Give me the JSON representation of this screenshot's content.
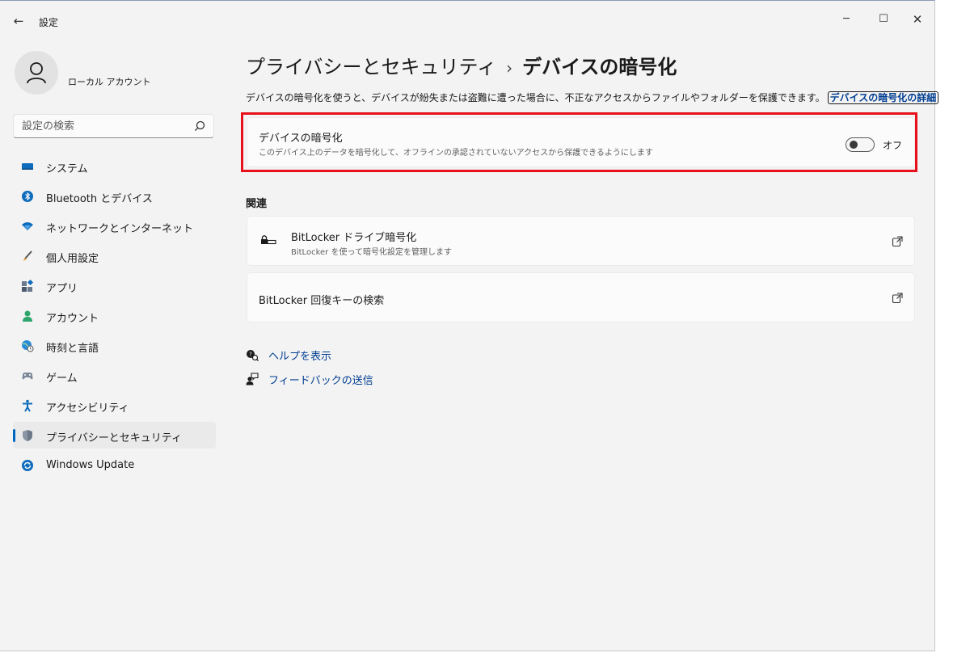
{
  "window": {
    "title": "設定",
    "controls": {
      "minimize": "─",
      "maximize": "☐",
      "close": "✕"
    }
  },
  "profile": {
    "name": "ローカル アカウント"
  },
  "search": {
    "placeholder": "設定の検索"
  },
  "sidebar": {
    "items": [
      {
        "label": "システム",
        "icon": "monitor-icon"
      },
      {
        "label": "Bluetooth とデバイス",
        "icon": "bluetooth-icon"
      },
      {
        "label": "ネットワークとインターネット",
        "icon": "wifi-icon"
      },
      {
        "label": "個人用設定",
        "icon": "brush-icon"
      },
      {
        "label": "アプリ",
        "icon": "apps-icon"
      },
      {
        "label": "アカウント",
        "icon": "account-icon"
      },
      {
        "label": "時刻と言語",
        "icon": "globe-clock-icon"
      },
      {
        "label": "ゲーム",
        "icon": "gamepad-icon"
      },
      {
        "label": "アクセシビリティ",
        "icon": "accessibility-icon"
      },
      {
        "label": "プライバシーとセキュリティ",
        "icon": "shield-icon",
        "selected": true
      },
      {
        "label": "Windows Update",
        "icon": "update-icon"
      }
    ]
  },
  "main": {
    "breadcrumb": {
      "parent": "プライバシーとセキュリティ",
      "separator": "›",
      "current": "デバイスの暗号化"
    },
    "description": "デバイスの暗号化を使うと、デバイスが紛失または盗難に遭った場合に、不正なアクセスからファイルやフォルダーを保護できます。",
    "description_link": "デバイスの暗号化の詳細",
    "encryption_card": {
      "title": "デバイスの暗号化",
      "subtitle": "このデバイス上のデータを暗号化して、オフラインの承認されていないアクセスから保護できるようにします",
      "toggle_state": "オフ",
      "toggle_on": false
    },
    "related_label": "関連",
    "related": [
      {
        "title": "BitLocker ドライブ暗号化",
        "subtitle": "BitLocker を使って暗号化設定を管理します"
      },
      {
        "title": "BitLocker 回復キーの検索"
      }
    ],
    "help_links": [
      {
        "label": "ヘルプを表示",
        "icon": "help-icon"
      },
      {
        "label": "フィードバックの送信",
        "icon": "feedback-icon"
      }
    ]
  },
  "colors": {
    "accent": "#0067c0",
    "link": "#003e92",
    "highlight": "#e8101b",
    "background": "#f3f3f3"
  }
}
